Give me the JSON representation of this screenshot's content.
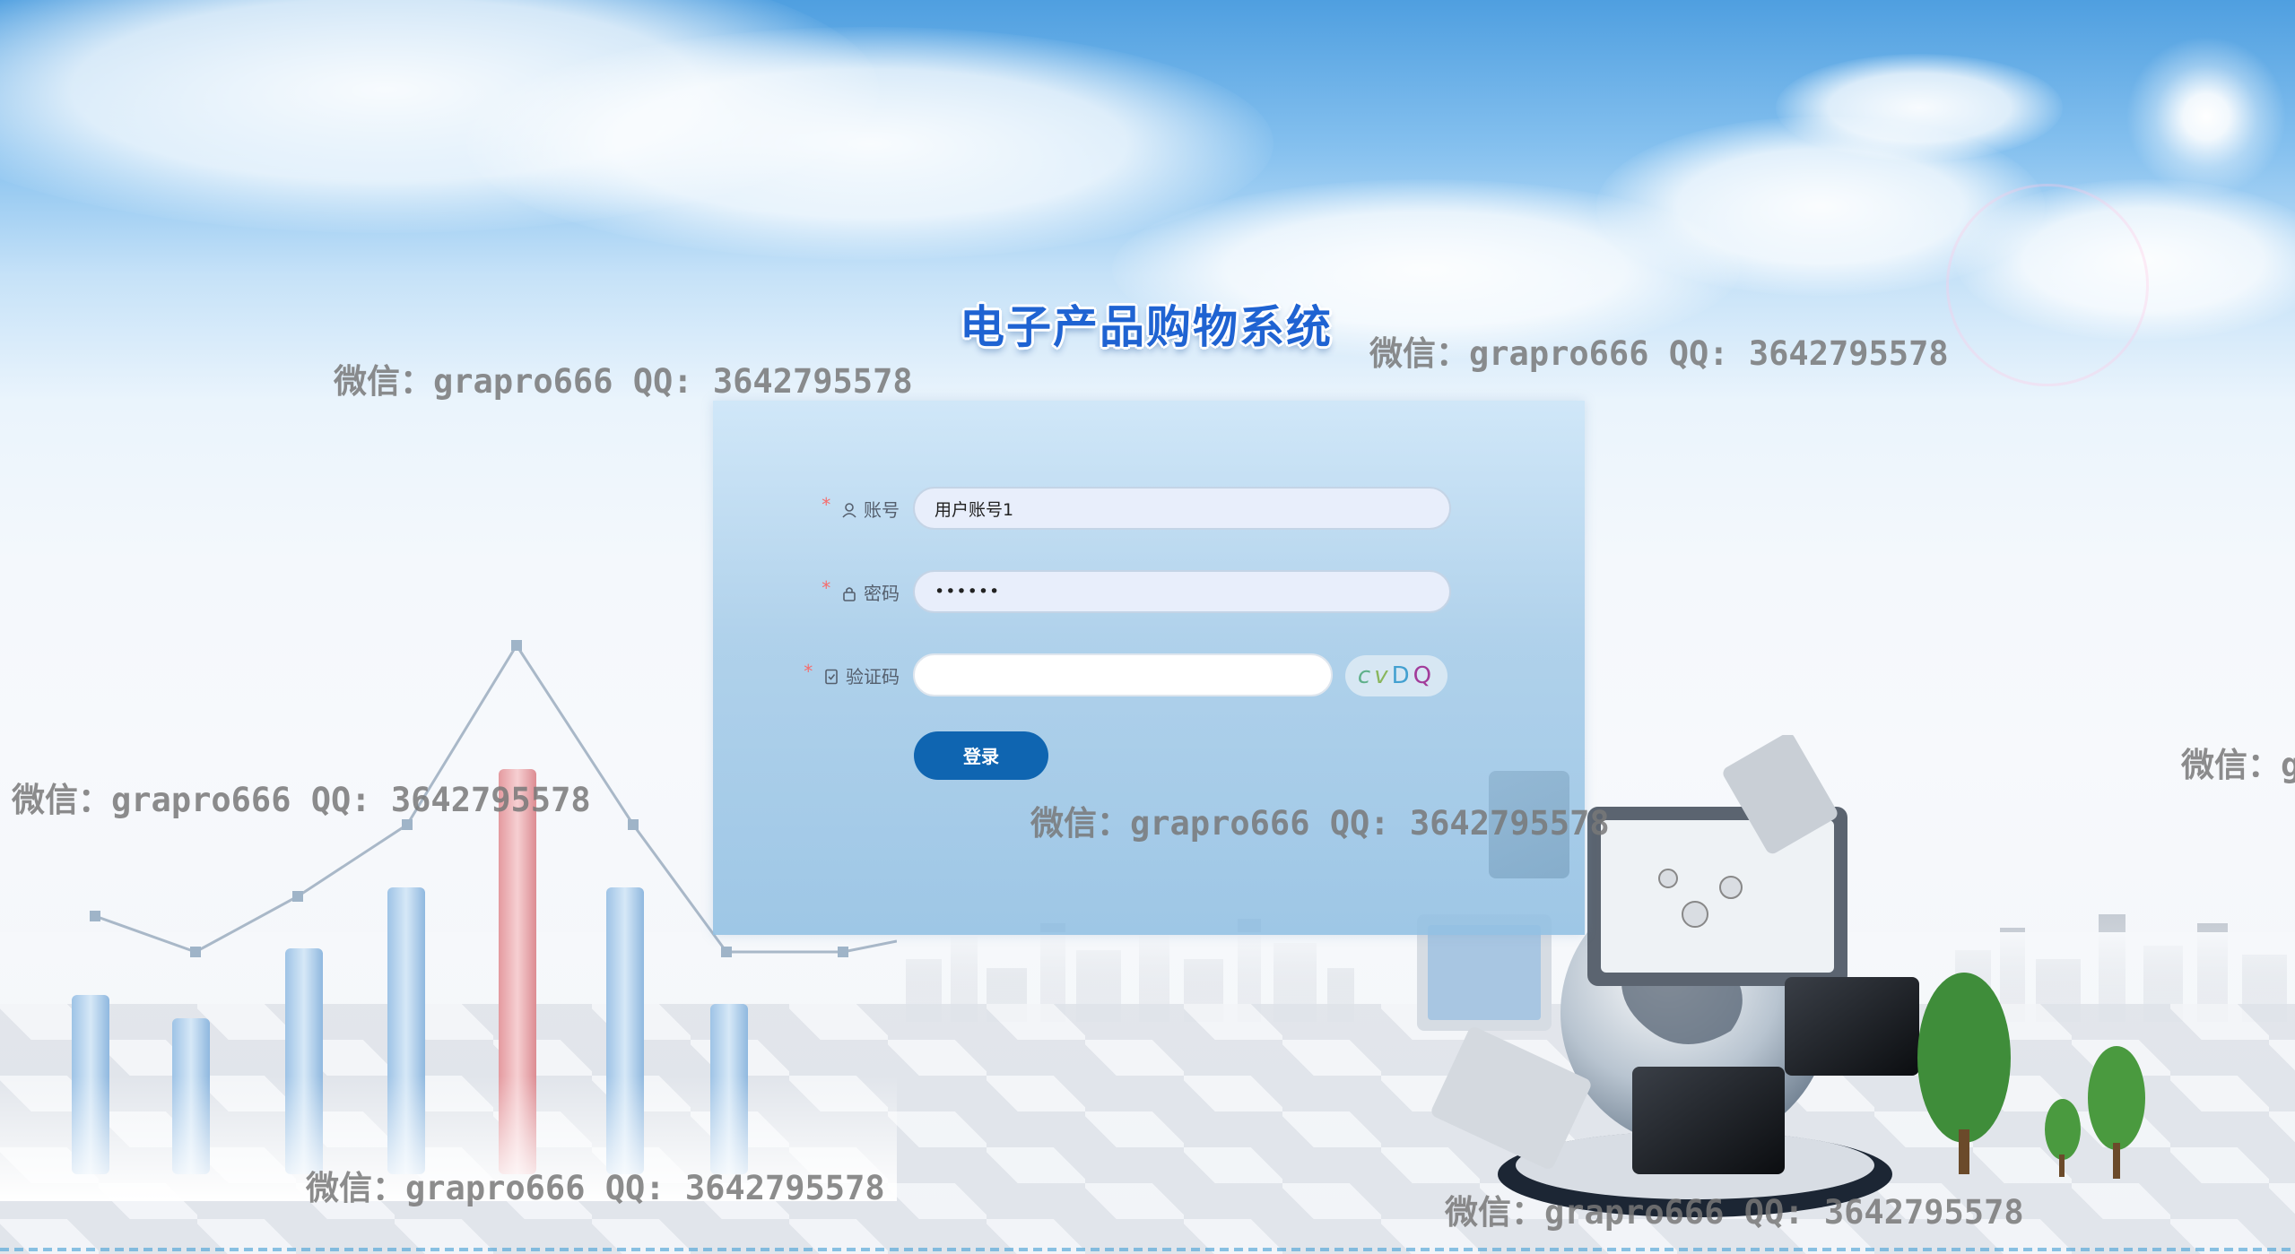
{
  "page": {
    "title": "电子产品购物系统"
  },
  "login_form": {
    "account": {
      "label": "账号",
      "required_mark": "*",
      "icon": "user-icon",
      "value": "用户账号1"
    },
    "password": {
      "label": "密码",
      "required_mark": "*",
      "icon": "lock-icon",
      "value": "••••••"
    },
    "captcha": {
      "label": "验证码",
      "required_mark": "*",
      "icon": "document-check-icon",
      "value": "",
      "code_chars": [
        "c",
        "v",
        "D",
        "Q"
      ]
    },
    "submit_label": "登录"
  },
  "watermarks": [
    "微信：grapro666 QQ: 3642795578",
    "微信：grapro666 QQ: 3642795578",
    "微信：grapro666 QQ: 3642795578",
    "微信：grapro666 QQ: 3642795578",
    "微信：grapro666 QQ: 3642795578",
    "微信：grapro666 QQ: 3642795578",
    "微信：g"
  ],
  "colors": {
    "primary_button": "#0f65b1",
    "title": "#1f63d2",
    "required": "#f56c6c"
  }
}
